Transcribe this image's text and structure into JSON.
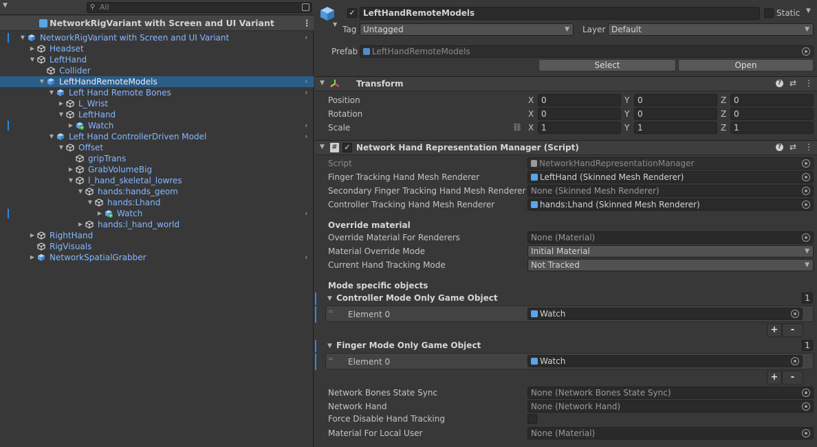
{
  "hierarchy": {
    "search_placeholder": "All",
    "scene_title": "NetworkRigVariant with Screen and UI Variant",
    "rows": [
      {
        "label": "NetworkRigVariant with Screen and UI Variant",
        "depth": 0,
        "arrow": "down",
        "icon": "prefab",
        "chev": true,
        "mark": true
      },
      {
        "label": "Headset",
        "depth": 1,
        "arrow": "right",
        "icon": "gameobject"
      },
      {
        "label": "LeftHand",
        "depth": 1,
        "arrow": "down",
        "icon": "gameobject"
      },
      {
        "label": "Collider",
        "depth": 2,
        "arrow": "",
        "icon": "gameobject"
      },
      {
        "label": "LeftHandRemoteModels",
        "depth": 2,
        "arrow": "down",
        "icon": "prefab",
        "chev": true,
        "selected": true
      },
      {
        "label": "Left Hand Remote Bones",
        "depth": 3,
        "arrow": "down",
        "icon": "prefab",
        "chev": true
      },
      {
        "label": "L_Wrist",
        "depth": 4,
        "arrow": "right",
        "icon": "gameobject"
      },
      {
        "label": "LeftHand",
        "depth": 4,
        "arrow": "down",
        "icon": "gameobject"
      },
      {
        "label": "Watch",
        "depth": 5,
        "arrow": "right",
        "icon": "prefab-added",
        "chev": true,
        "mark": true
      },
      {
        "label": "Left Hand ControllerDriven Model",
        "depth": 3,
        "arrow": "down",
        "icon": "prefab",
        "chev": true
      },
      {
        "label": "Offset",
        "depth": 4,
        "arrow": "down",
        "icon": "gameobject"
      },
      {
        "label": "gripTrans",
        "depth": 5,
        "arrow": "",
        "icon": "gameobject"
      },
      {
        "label": "GrabVolumeBig",
        "depth": 5,
        "arrow": "right",
        "icon": "gameobject"
      },
      {
        "label": "l_hand_skeletal_lowres",
        "depth": 5,
        "arrow": "down",
        "icon": "gameobject"
      },
      {
        "label": "hands:hands_geom",
        "depth": 6,
        "arrow": "down",
        "icon": "gameobject"
      },
      {
        "label": "hands:Lhand",
        "depth": 7,
        "arrow": "down",
        "icon": "gameobject"
      },
      {
        "label": "Watch",
        "depth": 8,
        "arrow": "right",
        "icon": "prefab-added",
        "chev": true,
        "mark": true
      },
      {
        "label": "hands:l_hand_world",
        "depth": 6,
        "arrow": "right",
        "icon": "gameobject"
      },
      {
        "label": "RightHand",
        "depth": 1,
        "arrow": "right",
        "icon": "gameobject"
      },
      {
        "label": "RigVisuals",
        "depth": 1,
        "arrow": "",
        "icon": "gameobject"
      },
      {
        "label": "NetworkSpatialGrabber",
        "depth": 1,
        "arrow": "right",
        "icon": "prefab",
        "chev": true
      }
    ]
  },
  "inspector": {
    "object_name": "LeftHandRemoteModels",
    "static_label": "Static",
    "tag_label": "Tag",
    "tag_value": "Untagged",
    "layer_label": "Layer",
    "layer_value": "Default",
    "prefab_label": "Prefab",
    "prefab_value": "LeftHandRemoteModels",
    "select_button": "Select",
    "open_button": "Open",
    "transform": {
      "title": "Transform",
      "position_label": "Position",
      "rotation_label": "Rotation",
      "scale_label": "Scale",
      "axis_x": "X",
      "axis_y": "Y",
      "axis_z": "Z",
      "position": [
        "0",
        "0",
        "0"
      ],
      "rotation": [
        "0",
        "0",
        "0"
      ],
      "scale": [
        "1",
        "1",
        "1"
      ]
    },
    "script_component": {
      "title": "Network Hand Representation Manager (Script)",
      "script_label": "Script",
      "script_value": "NetworkHandRepresentationManager",
      "finger_label": "Finger Tracking Hand Mesh Renderer",
      "finger_value": "LeftHand (Skinned Mesh Renderer)",
      "secondary_label": "Secondary Finger Tracking Hand Mesh Renderer",
      "secondary_value": "None (Skinned Mesh Renderer)",
      "controller_label": "Controller Tracking Hand Mesh Renderer",
      "controller_value": "hands:Lhand (Skinned Mesh Renderer)",
      "override_header": "Override material",
      "override_mat_label": "Override Material For Renderers",
      "override_mat_value": "None (Material)",
      "mode_label": "Material Override Mode",
      "mode_value": "Initial Material",
      "tracking_label": "Current Hand Tracking Mode",
      "tracking_value": "Not Tracked",
      "mode_specific_header": "Mode specific objects",
      "controller_list_label": "Controller Mode Only Game Object",
      "controller_list_count": "1",
      "controller_elem_label": "Element 0",
      "controller_elem_value": "Watch",
      "finger_list_label": "Finger Mode Only Game Object",
      "finger_list_count": "1",
      "finger_elem_label": "Element 0",
      "finger_elem_value": "Watch",
      "plus": "+",
      "minus": "-",
      "bones_label": "Network Bones State Sync",
      "bones_value": "None (Network Bones State Sync)",
      "nethand_label": "Network Hand",
      "nethand_value": "None (Network Hand)",
      "force_label": "Force Disable Hand Tracking",
      "local_label": "Material For Local User",
      "local_value": "None (Material)"
    }
  },
  "colors": {
    "selected_row": "#2c5d87",
    "prefab_text": "#85b8ff",
    "accent": "#2a8ae0"
  }
}
